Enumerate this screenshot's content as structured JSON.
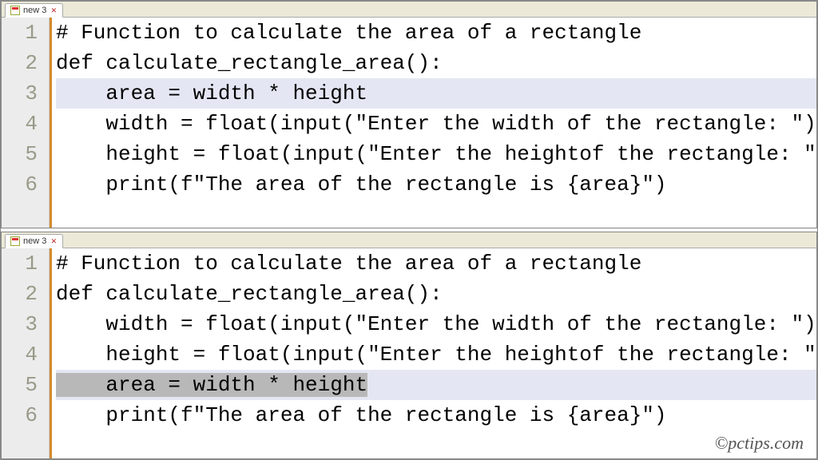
{
  "tabs": {
    "label": "new 3",
    "close_glyph": "✕"
  },
  "watermark": "©pctips.com",
  "panes": [
    {
      "lines": [
        {
          "n": "1",
          "text": "# Function to calculate the area of a rectangle"
        },
        {
          "n": "2",
          "text": "def calculate_rectangle_area():"
        },
        {
          "n": "3",
          "text": "    area = width * height",
          "highlight": "blue"
        },
        {
          "n": "4",
          "text": "    width = float(input(\"Enter the width of the rectangle: \"))"
        },
        {
          "n": "5",
          "text": "    height = float(input(\"Enter the heightof the rectangle: \"))"
        },
        {
          "n": "6",
          "text": "    print(f\"The area of the rectangle is {area}\")"
        }
      ]
    },
    {
      "lines": [
        {
          "n": "1",
          "text": "# Function to calculate the area of a rectangle"
        },
        {
          "n": "2",
          "text": "def calculate_rectangle_area():"
        },
        {
          "n": "3",
          "text": "    width = float(input(\"Enter the width of the rectangle: \"))"
        },
        {
          "n": "4",
          "text": "    height = float(input(\"Enter the heightof the rectangle: \")"
        },
        {
          "n": "5",
          "text": "    area = width * height",
          "highlight": "grey-select"
        },
        {
          "n": "6",
          "text": "    print(f\"The area of the rectangle is {area}\")"
        }
      ]
    }
  ]
}
